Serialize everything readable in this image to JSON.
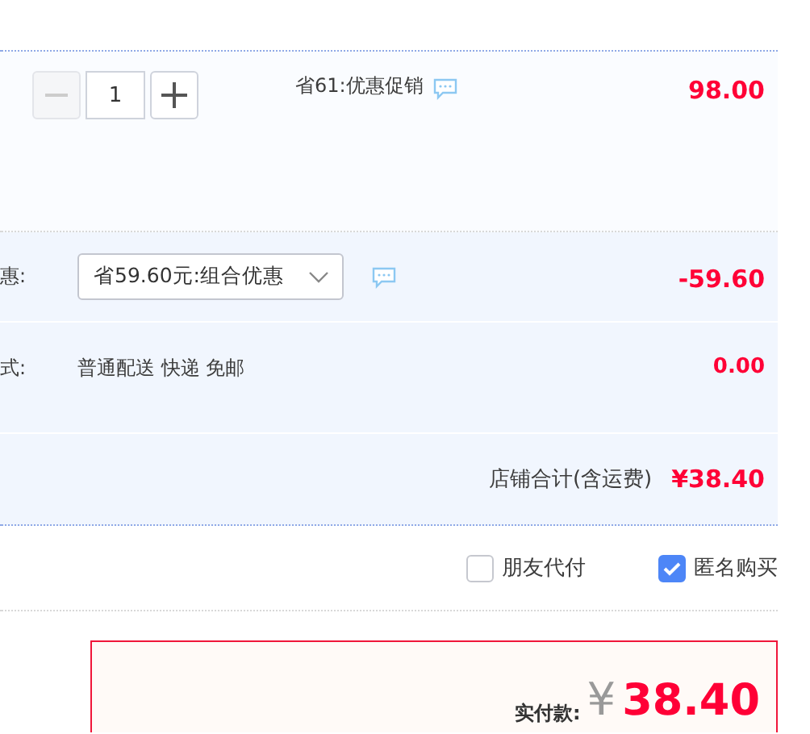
{
  "item": {
    "quantity": "1",
    "decrease_disabled": true,
    "promo": "省61:优惠促销",
    "price": "98.00"
  },
  "coupon": {
    "label": "惠:",
    "selected_option": "省59.60元:组合优惠",
    "amount": "-59.60"
  },
  "shipping": {
    "label": "式:",
    "method": "普通配送 快递 免邮",
    "amount": "0.00"
  },
  "store_total": {
    "label": "店铺合计(含运费)",
    "amount": "¥38.40"
  },
  "options": [
    {
      "label": "朋友代付",
      "checked": false
    },
    {
      "label": "匿名购买",
      "checked": true
    }
  ],
  "payment": {
    "label": "实付款:",
    "currency": "¥",
    "amount": "38.40"
  }
}
